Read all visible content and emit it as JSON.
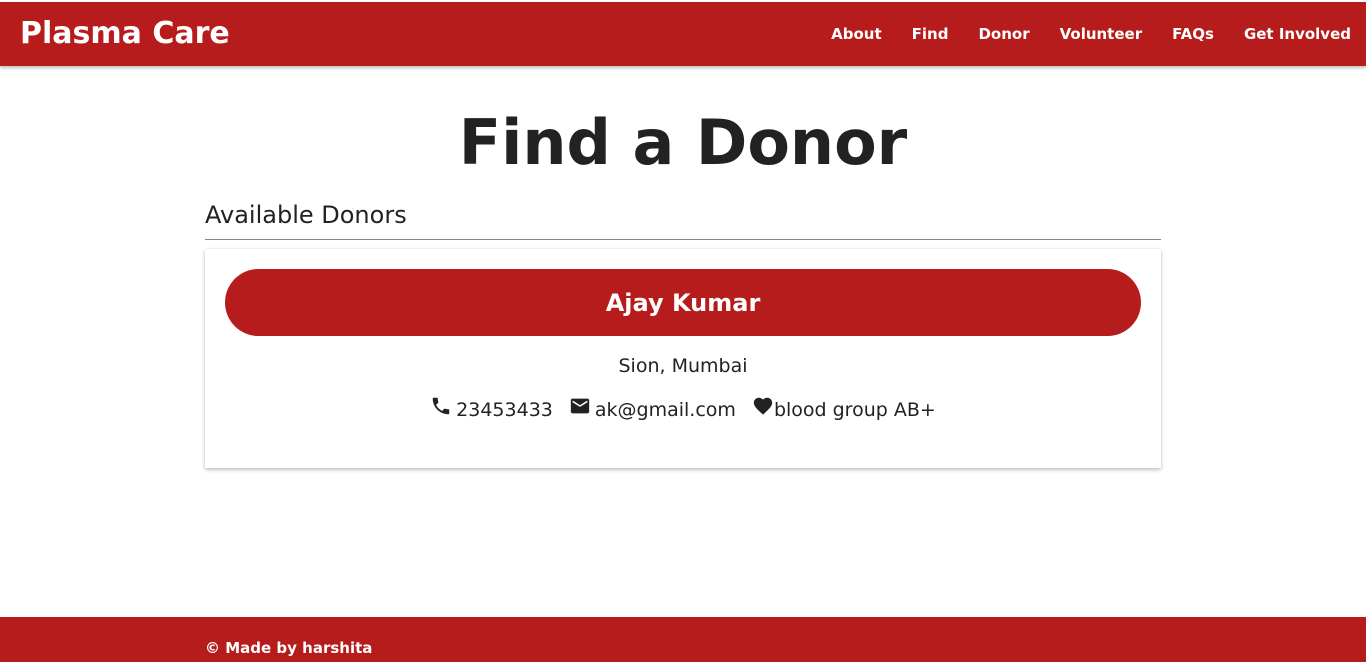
{
  "nav": {
    "brand": "Plasma Care",
    "links": [
      "About",
      "Find",
      "Donor",
      "Volunteer",
      "FAQs",
      "Get Involved"
    ]
  },
  "page": {
    "title": "Find a Donor",
    "section_heading": "Available Donors"
  },
  "donor": {
    "name": "Ajay Kumar",
    "location": "Sion, Mumbai",
    "phone": "23453433",
    "email": "ak@gmail.com",
    "blood_group": "blood group AB+",
    "icons": [
      "phone-icon",
      "mail-icon",
      "heart-icon"
    ]
  },
  "footer": {
    "text": "© Made by harshita"
  },
  "colors": {
    "brand_red": "#b71c1c",
    "text_dark": "#222222",
    "background": "#ffffff"
  }
}
